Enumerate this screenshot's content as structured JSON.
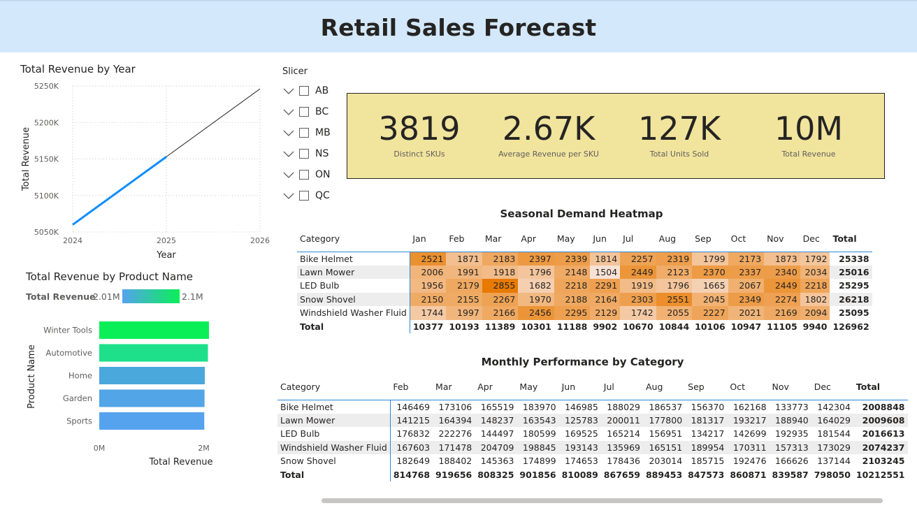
{
  "title": "Retail Sales Forecast",
  "line_chart": {
    "title": "Total Revenue by Year",
    "chart_data": {
      "type": "line",
      "title": "Total Revenue by Year",
      "xlabel": "Year",
      "ylabel": "Total Revenue",
      "x_ticks": [
        "2024",
        "2025",
        "2026"
      ],
      "y_ticks": [
        "5250K",
        "5200K",
        "5150K",
        "5100K",
        "5050K"
      ],
      "xlim": [
        2024,
        2026
      ],
      "ylim": [
        5050,
        5250
      ],
      "series": [
        {
          "values": [
            [
              2024,
              5060
            ],
            [
              2025,
              5153
            ]
          ],
          "color": "#118dff",
          "style": "actual"
        },
        {
          "values": [
            [
              2025,
              5153
            ],
            [
              2026,
              5246
            ]
          ],
          "color": "#252423",
          "style": "forecast"
        }
      ]
    }
  },
  "bar_chart": {
    "title": "Total Revenue by Product Name",
    "legend_label": "Total Revenue",
    "legend_min": "2.01M",
    "legend_max": "2.1M",
    "chart_data": {
      "type": "bar",
      "orientation": "horizontal",
      "categories": [
        "Winter Tools",
        "Automotive",
        "Home",
        "Garden",
        "Sports"
      ],
      "values": [
        2.1,
        2.08,
        2.02,
        2.015,
        2.01
      ],
      "colors": [
        "#0aef57",
        "#1ee08a",
        "#4ba8dc",
        "#52a5e6",
        "#55a3ee"
      ],
      "xlabel": "Total Revenue",
      "ylabel": "Product Name",
      "x_ticks": [
        "0M",
        "2M"
      ],
      "xlim": [
        0,
        2.1
      ]
    }
  },
  "slicer": {
    "title": "Slicer",
    "items": [
      "AB",
      "BC",
      "MB",
      "NS",
      "ON",
      "QC"
    ]
  },
  "kpis": [
    {
      "value": "3819",
      "label": "Distinct SKUs"
    },
    {
      "value": "2.67K",
      "label": "Average Revenue per SKU"
    },
    {
      "value": "127K",
      "label": "Total Units Sold"
    },
    {
      "value": "10M",
      "label": "Total Revenue"
    }
  ],
  "heatmap": {
    "title": "Seasonal Demand Heatmap",
    "headers": [
      "Category",
      "Jan",
      "Feb",
      "Mar",
      "Apr",
      "May",
      "Jun",
      "Jul",
      "Aug",
      "Sep",
      "Oct",
      "Nov",
      "Dec",
      "Total"
    ],
    "rows": [
      [
        "Bike Helmet",
        "2521",
        "1871",
        "2183",
        "2397",
        "2339",
        "1814",
        "2257",
        "2319",
        "1799",
        "2173",
        "1873",
        "1792",
        "25338"
      ],
      [
        "Lawn Mower",
        "2006",
        "1991",
        "1918",
        "1796",
        "2148",
        "1504",
        "2449",
        "2123",
        "2370",
        "2337",
        "2340",
        "2034",
        "25016"
      ],
      [
        "LED Bulb",
        "1956",
        "2179",
        "2855",
        "1682",
        "2218",
        "2291",
        "1919",
        "1796",
        "1665",
        "2067",
        "2449",
        "2218",
        "25295"
      ],
      [
        "Snow Shovel",
        "2150",
        "2155",
        "2267",
        "1970",
        "2188",
        "2164",
        "2303",
        "2551",
        "2045",
        "2349",
        "2274",
        "1802",
        "26218"
      ],
      [
        "Windshield Washer Fluid",
        "1744",
        "1997",
        "2166",
        "2456",
        "2295",
        "2129",
        "1742",
        "2055",
        "2227",
        "2021",
        "2169",
        "2094",
        "25095"
      ]
    ],
    "total_row": [
      "Total",
      "10377",
      "10193",
      "11389",
      "10301",
      "11188",
      "9902",
      "10670",
      "10844",
      "10106",
      "10947",
      "11105",
      "9940",
      "126962"
    ]
  },
  "monthly": {
    "title": "Monthly Performance by Category",
    "headers": [
      "Category",
      "Feb",
      "Mar",
      "Apr",
      "May",
      "Jun",
      "Jul",
      "Aug",
      "Sep",
      "Oct",
      "Nov",
      "Dec",
      "Total"
    ],
    "rows": [
      [
        "Bike Helmet",
        "146469",
        "173106",
        "165519",
        "183970",
        "146985",
        "188029",
        "186537",
        "156370",
        "162168",
        "133773",
        "142304",
        "2008848"
      ],
      [
        "Lawn Mower",
        "141215",
        "164394",
        "148237",
        "163543",
        "125783",
        "200011",
        "177800",
        "181317",
        "193217",
        "188940",
        "164029",
        "2009608"
      ],
      [
        "LED Bulb",
        "176832",
        "222276",
        "144497",
        "180599",
        "169525",
        "165214",
        "156951",
        "134217",
        "142699",
        "192935",
        "181544",
        "2016613"
      ],
      [
        "Windshield Washer Fluid",
        "167603",
        "171478",
        "204709",
        "198845",
        "193143",
        "135969",
        "165151",
        "189954",
        "170311",
        "157313",
        "173029",
        "2074237"
      ],
      [
        "Snow Shovel",
        "182649",
        "188402",
        "145363",
        "174899",
        "174653",
        "178436",
        "203014",
        "185715",
        "192476",
        "166626",
        "137144",
        "2103245"
      ]
    ],
    "total_row": [
      "Total",
      "814768",
      "919656",
      "808325",
      "901856",
      "810089",
      "867659",
      "889453",
      "847573",
      "860871",
      "839587",
      "798050",
      "10212551"
    ]
  }
}
